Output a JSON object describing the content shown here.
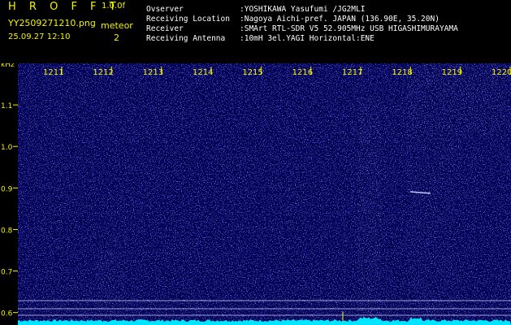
{
  "header": {
    "app_title": "H R O F F T",
    "app_version": "1.0.0f",
    "file_name": "YY2509271210.png",
    "timestamp": "25.09.27 12:10",
    "meteor_label": "meteor",
    "meteor_count": "2",
    "info": [
      {
        "key": "Ovserver",
        "value": ":YOSHIKAWA Yasufumi /JG2MLI"
      },
      {
        "key": "Receiving Location",
        "value": ":Nagoya Aichi-pref. JAPAN (136.90E, 35.20N)"
      },
      {
        "key": "Receiver",
        "value": ":SMArt RTL-SDR V5 52.905MHz USB HIGASHIMURAYAMA"
      },
      {
        "key": "Receiving Antenna",
        "value": ":10mH 3el.YAGI Horizontal:ENE"
      }
    ]
  },
  "chart_data": {
    "type": "heatmap",
    "ylabel": "kHz",
    "x_ticks": [
      "1211",
      "1212",
      "1213",
      "1214",
      "1215",
      "1216",
      "1217",
      "1218",
      "1219",
      "1220"
    ],
    "y_ticks": [
      "1.1",
      "1.0",
      "0.9",
      "0.8",
      "0.7",
      "0.6"
    ],
    "y_tick_values": [
      1.1,
      1.0,
      0.9,
      0.8,
      0.7,
      0.6
    ],
    "ylim": [
      0.57,
      1.2
    ],
    "colors": {
      "background": "#000050",
      "noise": "#2a2aff",
      "signal": "#c8c8ff",
      "ticks": "#f3f300",
      "baseline": "#00e5ff"
    }
  }
}
